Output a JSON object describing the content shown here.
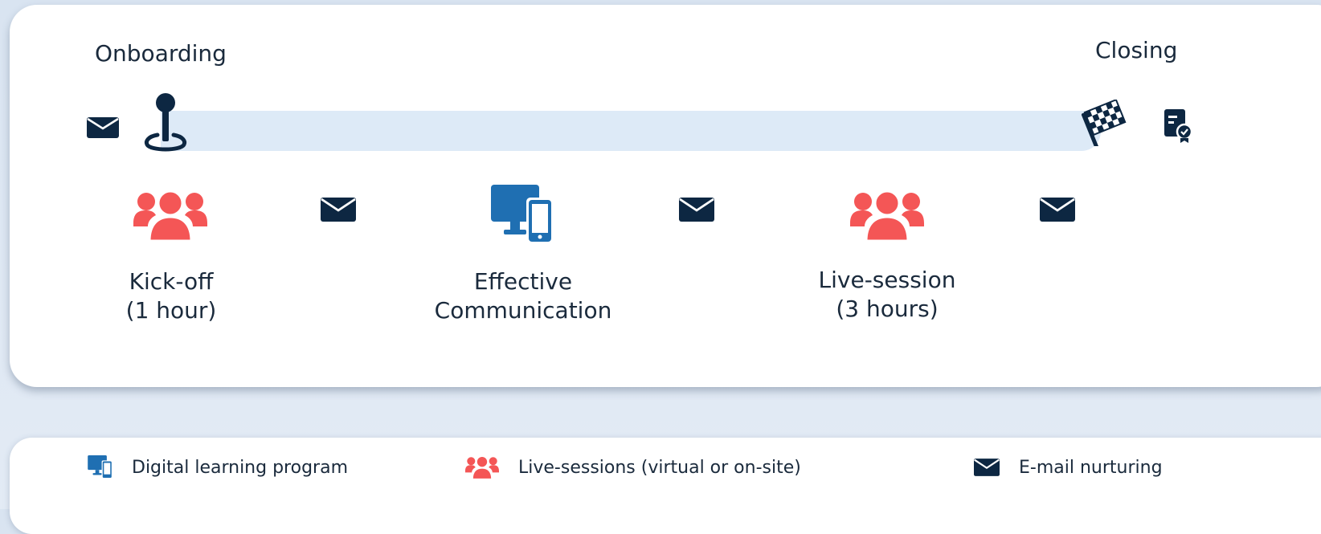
{
  "timeline": {
    "start_label": "Onboarding",
    "end_label": "Closing",
    "start_icons": [
      "envelope-icon",
      "map-pin-icon"
    ],
    "end_icons": [
      "checkered-flag-icon",
      "certificate-icon"
    ]
  },
  "steps": [
    {
      "type": "live-session",
      "icon": "people-group-icon",
      "line1": "Kick-off",
      "line2": "(1 hour)"
    },
    {
      "type": "email",
      "icon": "envelope-icon"
    },
    {
      "type": "digital",
      "icon": "devices-icon",
      "line1": "Effective",
      "line2": "Communication"
    },
    {
      "type": "email",
      "icon": "envelope-icon"
    },
    {
      "type": "live-session",
      "icon": "people-group-icon",
      "line1": "Live-session",
      "line2": "(3 hours)"
    },
    {
      "type": "email",
      "icon": "envelope-icon"
    }
  ],
  "legend": {
    "digital": "Digital learning program",
    "live": "Live-sessions (virtual or on-site)",
    "email": "E-mail nurturing"
  },
  "colors": {
    "navy": "#0d2742",
    "coral": "#f45656",
    "blue": "#1f6fb2",
    "track": "#ddeaf7"
  }
}
